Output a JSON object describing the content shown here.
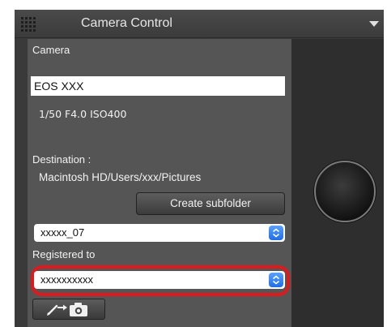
{
  "panel": {
    "title": "Camera Control"
  },
  "camera": {
    "label": "Camera",
    "name": "EOS XXX",
    "settings": "1/50  F4.0  ISO400"
  },
  "destination": {
    "label": "Destination :",
    "path": "Macintosh HD/Users/xxx/Pictures",
    "create_subfolder_label": "Create subfolder",
    "folder_value": "xxxxx_07"
  },
  "registration": {
    "label": "Registered to",
    "owner_value": "xxxxxxxxxx"
  },
  "colors": {
    "highlight": "#e0191d",
    "stepper": "#1f6fe8"
  },
  "icons": {
    "transfer_button": "pen-arrow-camera-icon",
    "select_arrows": "up-down-chevron-icon",
    "panel_menu": "triangle-down-icon",
    "grip": "grip-dots-icon"
  }
}
